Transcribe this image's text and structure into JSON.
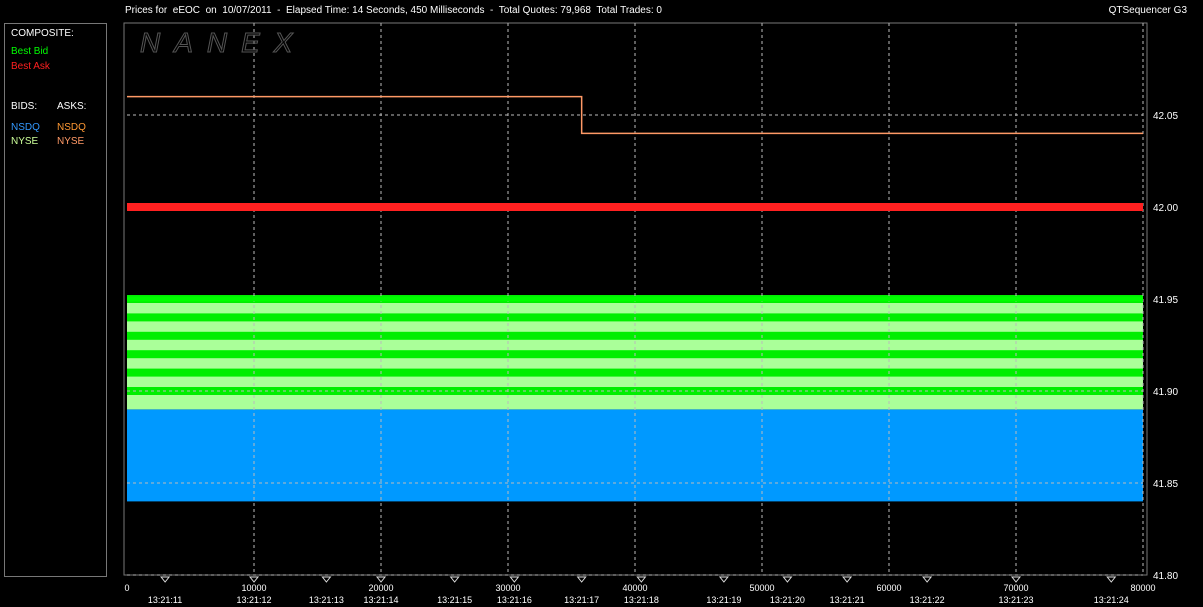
{
  "window": {
    "title": "Prices for  eEOC  on  10/07/2011  -  Elapsed Time: 14 Seconds, 450 Milliseconds  -  Total Quotes: 79,968  Total Trades: 0",
    "app_name": "QTSequencer G3"
  },
  "legend": {
    "composite_label": "COMPOSITE:",
    "best_bid": "Best Bid",
    "best_ask": "Best Ask",
    "bids_label": "BIDS:",
    "asks_label": "ASKS:",
    "bid_exchanges": [
      "NSDQ",
      "NYSE"
    ],
    "ask_exchanges": [
      "NSDQ",
      "NYSE"
    ],
    "colors": {
      "best_bid": "#00ff00",
      "best_ask": "#ff2020",
      "nsdq_bid": "#3399ff",
      "nyse_bid": "#ccff99",
      "nsdq_ask": "#ff9933",
      "nyse_ask": "#ff9966"
    }
  },
  "watermark": "NANEX",
  "chart_data": {
    "type": "line",
    "xlim": [
      0,
      80000
    ],
    "ylim": [
      41.8,
      42.1
    ],
    "x_ticks": [
      0,
      10000,
      20000,
      30000,
      40000,
      50000,
      60000,
      70000,
      80000
    ],
    "x_tick_labels": [
      "0",
      "10000",
      "20000",
      "30000",
      "40000",
      "50000",
      "60000",
      "70000",
      "80000"
    ],
    "y_ticks": [
      41.8,
      41.85,
      41.9,
      41.95,
      42.0,
      42.05
    ],
    "y_tick_labels": [
      "41.80",
      "41.85",
      "41.90",
      "41.95",
      "42.00",
      "42.05"
    ],
    "time_labels": [
      "13:21:11",
      "13:21:12",
      "13:21:13",
      "13:21:14",
      "13:21:15",
      "13:21:16",
      "13:21:17",
      "13:21:18",
      "13:21:19",
      "13:21:20",
      "13:21:21",
      "13:21:22",
      "13:21:23",
      "13:21:24"
    ],
    "time_label_x": [
      3000,
      10000,
      15700,
      20000,
      25800,
      30500,
      35800,
      40500,
      47000,
      52000,
      56700,
      63000,
      70000,
      77500
    ],
    "series": [
      {
        "name": "Best Ask",
        "color": "#ff2020",
        "points": [
          [
            0,
            42.0
          ],
          [
            80000,
            42.0
          ]
        ]
      },
      {
        "name": "NSDQ",
        "side": "ask",
        "color": "#ff9966",
        "points": [
          [
            0,
            42.06
          ],
          [
            35800,
            42.06
          ],
          [
            35800,
            42.04
          ],
          [
            80000,
            42.04
          ]
        ]
      },
      {
        "name": "Best Bid",
        "color": "#00ff00",
        "points": [
          [
            0,
            41.95
          ],
          [
            80000,
            41.95
          ]
        ]
      }
    ],
    "bid_bands": [
      {
        "exchange": "NSDQ",
        "color": "#0099ff",
        "from": 41.84,
        "to": 41.89
      },
      {
        "exchange": "NYSE",
        "color": "#aaff99",
        "from": 41.89,
        "to": 41.95
      }
    ],
    "bid_levels": [
      41.95,
      41.94,
      41.93,
      41.92,
      41.91,
      41.9
    ],
    "grid": true
  }
}
